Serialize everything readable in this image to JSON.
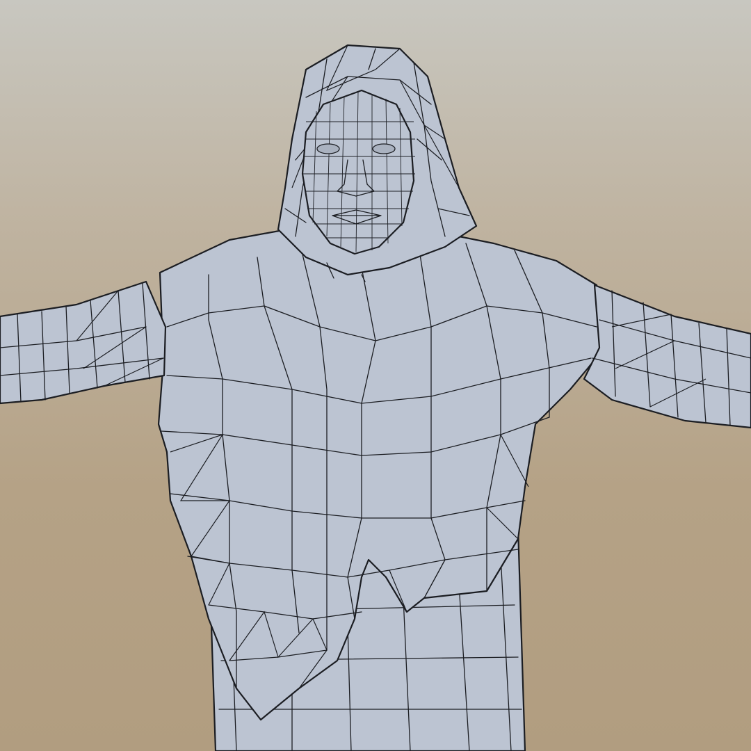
{
  "scene": {
    "subject": "wireframe-character-model",
    "colors": {
      "background_top": "#c8c7c0",
      "background_bottom": "#b19d80",
      "mesh_fill": "#bcc4d2",
      "mesh_shadow": "#8f98a8",
      "mesh_highlight": "#dfe5ee",
      "wire": "#1b1d22"
    }
  }
}
